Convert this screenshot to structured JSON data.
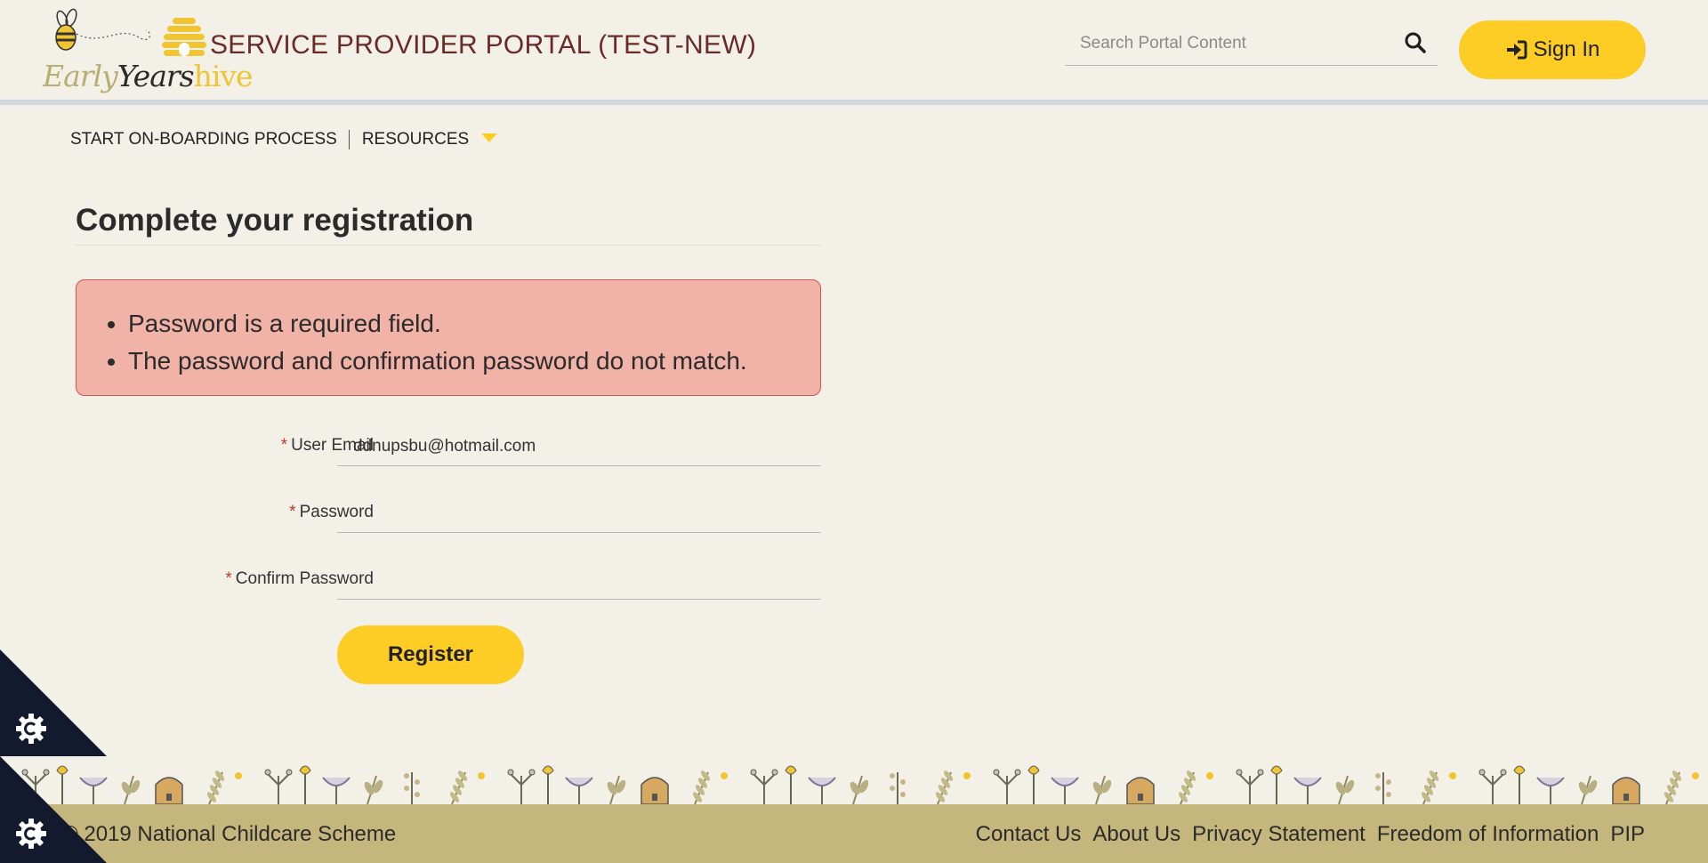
{
  "header": {
    "logo": {
      "early": "Early",
      "years": "Years",
      "hive": "hive"
    },
    "portal_title": "SERVICE PROVIDER PORTAL (TEST-NEW)",
    "search": {
      "placeholder": "Search Portal Content",
      "icon": "search-icon"
    },
    "signin_label": "Sign In",
    "signin_icon": "sign-in-icon"
  },
  "nav": {
    "items": [
      {
        "label": "START ON-BOARDING PROCESS"
      },
      {
        "label": "RESOURCES",
        "icon": "caret-down-icon"
      }
    ]
  },
  "main": {
    "title": "Complete your registration",
    "errors": [
      "Password is a required field.",
      "The password and confirmation password do not match."
    ],
    "form": {
      "required_marker": "*",
      "email_label": "User Email",
      "email_value": "ddnupsbu@hotmail.com",
      "password_label": "Password",
      "password_value": "",
      "confirm_label": "Confirm Password",
      "confirm_value": "",
      "register_label": "Register"
    }
  },
  "footer": {
    "copyright": "© 2019 National Childcare Scheme",
    "links": [
      "Contact Us",
      "About Us",
      "Privacy Statement",
      "Freedom of Information",
      "PIP"
    ]
  },
  "colors": {
    "background": "#f3f0e7",
    "accent": "#fdcd26",
    "title": "#6b2a2a",
    "error_bg": "#f1b2a8",
    "error_border": "#d9534f",
    "footer": "#c4b67c",
    "corner": "#141a2e"
  }
}
